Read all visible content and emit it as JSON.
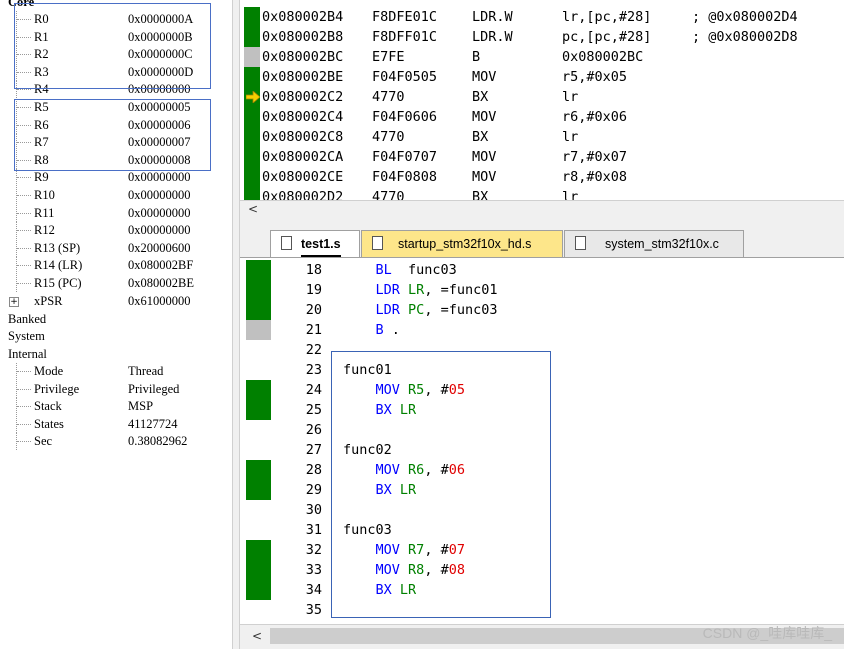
{
  "colors": {
    "green_bar": "#008000",
    "gray_bar": "#c0c0c0",
    "highlight_border": "#4a6fc6",
    "arrow": "#f5d000",
    "tab_active": "#ffffff",
    "tab_yellow": "#fde68a",
    "tab_inactive": "#f0f0f0",
    "watermark": "#b9b9b9"
  },
  "registers": {
    "core_label": "Core",
    "rows": [
      {
        "name": "R0",
        "value": "0x0000000A"
      },
      {
        "name": "R1",
        "value": "0x0000000B"
      },
      {
        "name": "R2",
        "value": "0x0000000C"
      },
      {
        "name": "R3",
        "value": "0x0000000D"
      },
      {
        "name": "R4",
        "value": "0x00000000"
      },
      {
        "name": "R5",
        "value": "0x00000005"
      },
      {
        "name": "R6",
        "value": "0x00000006"
      },
      {
        "name": "R7",
        "value": "0x00000007"
      },
      {
        "name": "R8",
        "value": "0x00000008"
      },
      {
        "name": "R9",
        "value": "0x00000000"
      },
      {
        "name": "R10",
        "value": "0x00000000"
      },
      {
        "name": "R11",
        "value": "0x00000000"
      },
      {
        "name": "R12",
        "value": "0x00000000"
      },
      {
        "name": "R13 (SP)",
        "value": "0x20000600"
      },
      {
        "name": "R14 (LR)",
        "value": "0x080002BF"
      },
      {
        "name": "R15 (PC)",
        "value": "0x080002BE"
      },
      {
        "name": "xPSR",
        "value": "0x61000000"
      }
    ],
    "groups": [
      "Banked",
      "System",
      "Internal"
    ],
    "internal": [
      {
        "name": "Mode",
        "value": "Thread"
      },
      {
        "name": "Privilege",
        "value": "Privileged"
      },
      {
        "name": "Stack",
        "value": "MSP"
      },
      {
        "name": "States",
        "value": "41127724"
      },
      {
        "name": "Sec",
        "value": "0.38082962"
      }
    ]
  },
  "disassembly": [
    {
      "bar": "green",
      "addr": "0x080002B4",
      "opcode": "F8DFE01C",
      "mnemonic": "LDR.W",
      "args": "lr,[pc,#28]",
      "comment": "; @0x080002D4"
    },
    {
      "bar": "green",
      "addr": "0x080002B8",
      "opcode": "F8DFF01C",
      "mnemonic": "LDR.W",
      "args": "pc,[pc,#28]",
      "comment": "; @0x080002D8"
    },
    {
      "bar": "gray",
      "addr": "0x080002BC",
      "opcode": "E7FE",
      "mnemonic": "B",
      "args": "0x080002BC",
      "comment": ""
    },
    {
      "bar": "green",
      "addr": "0x080002BE",
      "opcode": "F04F0505",
      "mnemonic": "MOV",
      "args": "r5,#0x05",
      "comment": ""
    },
    {
      "bar": "arrow",
      "addr": "0x080002C2",
      "opcode": "4770",
      "mnemonic": "BX",
      "args": "lr",
      "comment": ""
    },
    {
      "bar": "green",
      "addr": "0x080002C4",
      "opcode": "F04F0606",
      "mnemonic": "MOV",
      "args": "r6,#0x06",
      "comment": ""
    },
    {
      "bar": "green",
      "addr": "0x080002C8",
      "opcode": "4770",
      "mnemonic": "BX",
      "args": "lr",
      "comment": ""
    },
    {
      "bar": "green",
      "addr": "0x080002CA",
      "opcode": "F04F0707",
      "mnemonic": "MOV",
      "args": "r7,#0x07",
      "comment": ""
    },
    {
      "bar": "green",
      "addr": "0x080002CE",
      "opcode": "F04F0808",
      "mnemonic": "MOV",
      "args": "r8,#0x08",
      "comment": ""
    },
    {
      "bar": "green",
      "addr": "0x080002D2",
      "opcode": "4770",
      "mnemonic": "BX",
      "args": "lr",
      "comment": ""
    }
  ],
  "scroll_left": "<",
  "tabs": [
    {
      "label": "test1.s",
      "active": true
    },
    {
      "label": "startup_stm32f10x_hd.s",
      "active": false
    },
    {
      "label": "system_stm32f10x.c",
      "active": false
    }
  ],
  "editor": [
    {
      "ln": "18",
      "bar": "green",
      "tokens": [
        [
          "    ",
          ""
        ],
        [
          "BL",
          "kw"
        ],
        [
          "  func03",
          ""
        ]
      ]
    },
    {
      "ln": "19",
      "bar": "green",
      "tokens": [
        [
          "    ",
          ""
        ],
        [
          "LDR",
          "kw"
        ],
        [
          " ",
          ""
        ],
        [
          "LR",
          "rg"
        ],
        [
          ", =func01",
          ""
        ]
      ]
    },
    {
      "ln": "20",
      "bar": "green",
      "tokens": [
        [
          "    ",
          ""
        ],
        [
          "LDR",
          "kw"
        ],
        [
          " ",
          ""
        ],
        [
          "PC",
          "rg"
        ],
        [
          ", =func03",
          ""
        ]
      ]
    },
    {
      "ln": "21",
      "bar": "gray",
      "tokens": [
        [
          "    ",
          ""
        ],
        [
          "B",
          "kw"
        ],
        [
          " .",
          ""
        ]
      ]
    },
    {
      "ln": "22",
      "bar": "",
      "tokens": []
    },
    {
      "ln": "23",
      "bar": "",
      "tokens": [
        [
          "func01",
          ""
        ]
      ]
    },
    {
      "ln": "24",
      "bar": "green",
      "tokens": [
        [
          "    ",
          ""
        ],
        [
          "MOV",
          "kw"
        ],
        [
          " ",
          ""
        ],
        [
          "R5",
          "rg"
        ],
        [
          ", #",
          ""
        ],
        [
          "05",
          "nb"
        ]
      ]
    },
    {
      "ln": "25",
      "bar": "green",
      "tokens": [
        [
          "    ",
          ""
        ],
        [
          "BX",
          "kw"
        ],
        [
          " ",
          ""
        ],
        [
          "LR",
          "rg"
        ]
      ]
    },
    {
      "ln": "26",
      "bar": "",
      "tokens": []
    },
    {
      "ln": "27",
      "bar": "",
      "tokens": [
        [
          "func02",
          ""
        ]
      ]
    },
    {
      "ln": "28",
      "bar": "green",
      "tokens": [
        [
          "    ",
          ""
        ],
        [
          "MOV",
          "kw"
        ],
        [
          " ",
          ""
        ],
        [
          "R6",
          "rg"
        ],
        [
          ", #",
          ""
        ],
        [
          "06",
          "nb"
        ]
      ]
    },
    {
      "ln": "29",
      "bar": "green",
      "tokens": [
        [
          "    ",
          ""
        ],
        [
          "BX",
          "kw"
        ],
        [
          " ",
          ""
        ],
        [
          "LR",
          "rg"
        ]
      ]
    },
    {
      "ln": "30",
      "bar": "",
      "tokens": []
    },
    {
      "ln": "31",
      "bar": "",
      "tokens": [
        [
          "func03",
          ""
        ]
      ]
    },
    {
      "ln": "32",
      "bar": "green",
      "tokens": [
        [
          "    ",
          ""
        ],
        [
          "MOV",
          "kw"
        ],
        [
          " ",
          ""
        ],
        [
          "R7",
          "rg"
        ],
        [
          ", #",
          ""
        ],
        [
          "07",
          "nb"
        ]
      ]
    },
    {
      "ln": "33",
      "bar": "green",
      "tokens": [
        [
          "    ",
          ""
        ],
        [
          "MOV",
          "kw"
        ],
        [
          " ",
          ""
        ],
        [
          "R8",
          "rg"
        ],
        [
          ", #",
          ""
        ],
        [
          "08",
          "nb"
        ]
      ]
    },
    {
      "ln": "34",
      "bar": "green",
      "tokens": [
        [
          "    ",
          ""
        ],
        [
          "BX",
          "kw"
        ],
        [
          " ",
          ""
        ],
        [
          "LR",
          "rg"
        ]
      ]
    },
    {
      "ln": "35",
      "bar": "",
      "tokens": []
    }
  ],
  "watermark": "CSDN @_哇库哇库_"
}
